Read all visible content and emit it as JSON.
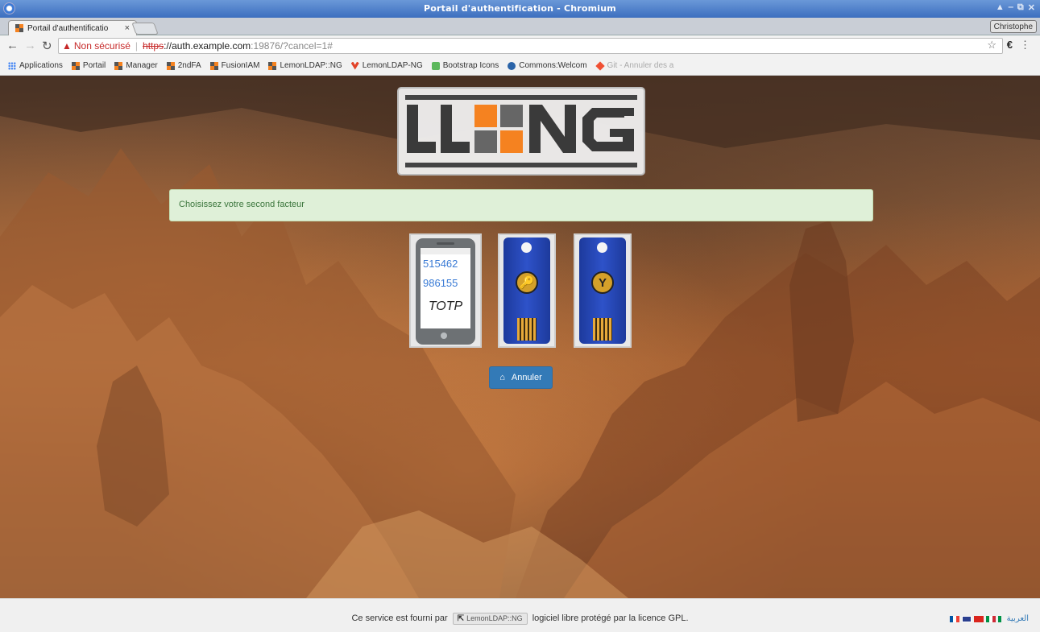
{
  "window": {
    "title": "Portail d'authentification - Chromium",
    "controls": [
      "▲",
      "‒",
      "⧉",
      "✕"
    ]
  },
  "tab": {
    "title": "Portail d'authentificatio",
    "close": "×"
  },
  "profile": {
    "name": "Christophe"
  },
  "address": {
    "security_label": "Non sécurisé",
    "separator": "|",
    "scheme": "https",
    "host": "://auth.example.com",
    "rest": ":19876/?cancel=1#"
  },
  "bookmarks": [
    {
      "label": "Applications",
      "icon": "apps-icon"
    },
    {
      "label": "Portail",
      "icon": "lemonldap-icon"
    },
    {
      "label": "Manager",
      "icon": "lemonldap-icon"
    },
    {
      "label": "2ndFA",
      "icon": "lemonldap-icon"
    },
    {
      "label": "FusionIAM",
      "icon": "lemonldap-icon"
    },
    {
      "label": "LemonLDAP::NG",
      "icon": "lemonldap-icon"
    },
    {
      "label": "LemonLDAP-NG",
      "icon": "gitlab-icon"
    },
    {
      "label": "Bootstrap Icons",
      "icon": "bootstrap-icon"
    },
    {
      "label": "Commons:Welcom",
      "icon": "wikimedia-icon"
    },
    {
      "label": "Git - Annuler des a",
      "icon": "git-icon"
    }
  ],
  "main": {
    "logo_text": "LL::NG",
    "message": "Choisissez votre second facteur",
    "factors": [
      {
        "name": "TOTP",
        "codes": [
          "515462",
          "986155"
        ],
        "label": "TOTP"
      },
      {
        "name": "U2F",
        "symbol": "🔑"
      },
      {
        "name": "Yubikey",
        "symbol": "Y"
      }
    ],
    "cancel_label": "Annuler"
  },
  "footer": {
    "prefix": "Ce service est fourni par",
    "product": "LemonLDAP::NG",
    "suffix": "logiciel libre protégé par la licence GPL.",
    "arabic_label": "العربية"
  },
  "colors": {
    "lemon_orange": "#f58220",
    "lemon_gray": "#555555",
    "alert_bg": "#dff0d8",
    "alert_text": "#3c763d",
    "button_blue": "#337ab7"
  }
}
